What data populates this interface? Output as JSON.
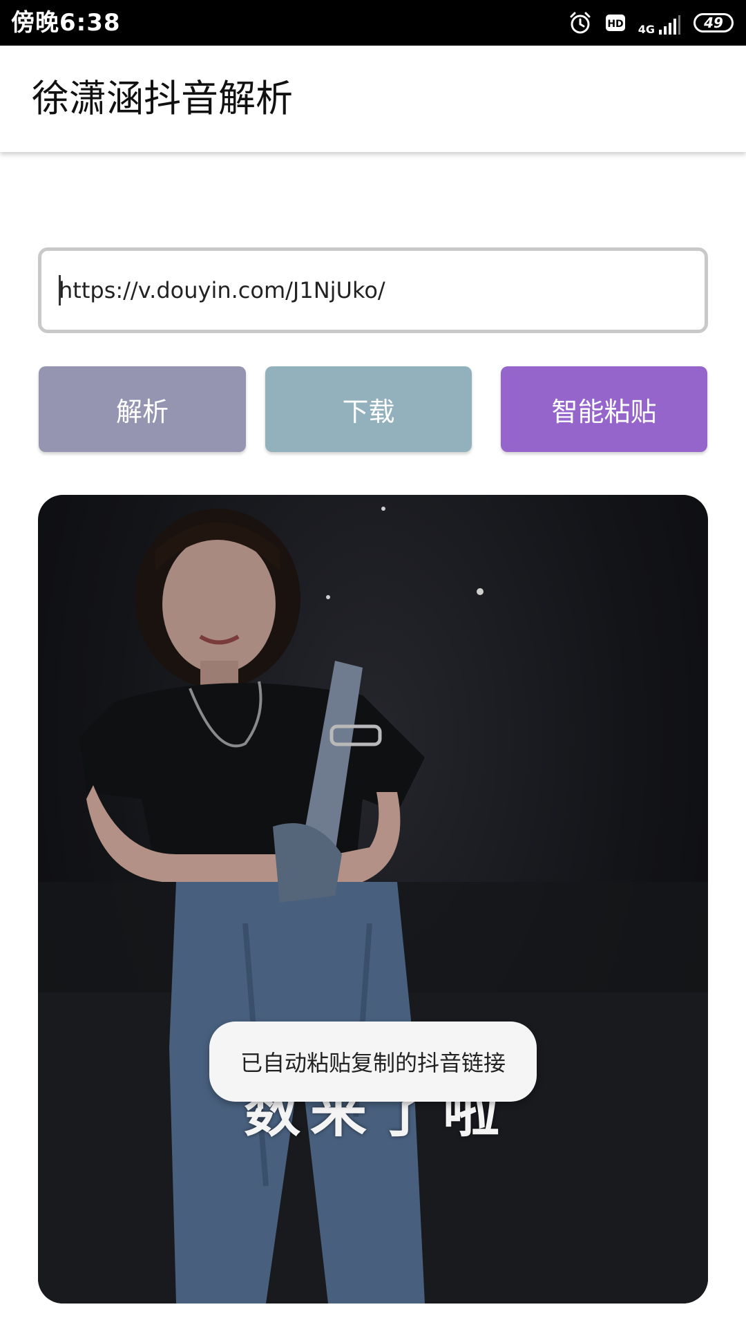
{
  "status_bar": {
    "time": "傍晚6:38",
    "network": "4G",
    "hd_label": "HD",
    "battery": "49",
    "icons": [
      "alarm-icon",
      "hd-icon",
      "signal-icon",
      "battery-icon"
    ]
  },
  "app_bar": {
    "title": "徐潇涵抖音解析"
  },
  "url_input": {
    "value": "https://v.douyin.com/J1NjUko/"
  },
  "buttons": {
    "parse": {
      "label": "解析",
      "color": "#9595b2"
    },
    "download": {
      "label": "下载",
      "color": "#92b1bc"
    },
    "smart_paste": {
      "label": "智能粘贴",
      "color": "#9565cc"
    }
  },
  "video": {
    "subtitle": "数来了啦"
  },
  "toast": {
    "message": "已自动粘贴复制的抖音链接"
  }
}
